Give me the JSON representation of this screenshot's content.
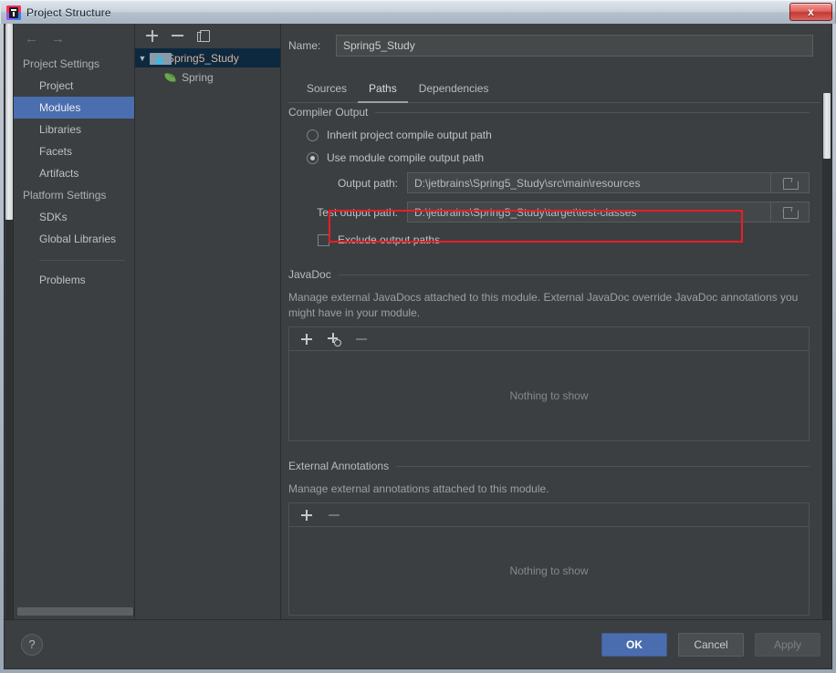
{
  "window": {
    "title": "Project Structure",
    "app_icon": "jetbrains-icon",
    "close_label": "x"
  },
  "sidebar": {
    "back_icon": "arrow-left-icon",
    "forward_icon": "arrow-right-icon",
    "groups": [
      {
        "label": "Project Settings",
        "items": [
          {
            "label": "Project",
            "selected": false
          },
          {
            "label": "Modules",
            "selected": true
          },
          {
            "label": "Libraries",
            "selected": false
          },
          {
            "label": "Facets",
            "selected": false
          },
          {
            "label": "Artifacts",
            "selected": false
          }
        ]
      },
      {
        "label": "Platform Settings",
        "items": [
          {
            "label": "SDKs",
            "selected": false
          },
          {
            "label": "Global Libraries",
            "selected": false
          }
        ]
      }
    ],
    "problems": {
      "label": "Problems"
    }
  },
  "tree": {
    "toolbar": [
      {
        "icon": "plus-icon",
        "label": "Add"
      },
      {
        "icon": "minus-icon",
        "label": "Remove"
      },
      {
        "icon": "copy-icon",
        "label": "Copy"
      }
    ],
    "root": {
      "label": "Spring5_Study",
      "icon": "module-folder-icon",
      "expanded": true,
      "selected": true
    },
    "children": [
      {
        "label": "Spring",
        "icon": "spring-leaf-icon"
      }
    ]
  },
  "main": {
    "name": {
      "label": "Name:",
      "value": "Spring5_Study",
      "placeholder": ""
    },
    "tabs": [
      {
        "label": "Sources",
        "active": false
      },
      {
        "label": "Paths",
        "active": true
      },
      {
        "label": "Dependencies",
        "active": false
      }
    ],
    "compiler_output": {
      "title": "Compiler Output",
      "radio_inherit": {
        "label": "Inherit project compile output path",
        "checked": false
      },
      "radio_module": {
        "label": "Use module compile output path",
        "checked": true
      },
      "output_path": {
        "label": "Output path:",
        "value": "D:\\jetbrains\\Spring5_Study\\src\\main\\resources",
        "browse_icon": "folder-icon",
        "highlighted": true
      },
      "test_output_path": {
        "label": "Test output path:",
        "value": "D:\\jetbrains\\Spring5_Study\\target\\test-classes",
        "browse_icon": "folder-icon"
      },
      "exclude_checkbox": {
        "label": "Exclude output paths",
        "checked": false
      }
    },
    "javadoc": {
      "title": "JavaDoc",
      "description": "Manage external JavaDocs attached to this module. External JavaDoc override JavaDoc annotations you might have in your module.",
      "toolbar": [
        {
          "icon": "plus-icon",
          "enabled": true
        },
        {
          "icon": "plus-web-icon",
          "enabled": true
        },
        {
          "icon": "minus-icon",
          "enabled": false
        }
      ],
      "empty_text": "Nothing to show"
    },
    "external_annotations": {
      "title": "External Annotations",
      "description": "Manage external annotations attached to this module.",
      "toolbar": [
        {
          "icon": "plus-icon",
          "enabled": true
        },
        {
          "icon": "minus-icon",
          "enabled": false
        }
      ],
      "empty_text": "Nothing to show"
    }
  },
  "footer": {
    "help_label": "?",
    "ok_label": "OK",
    "cancel_label": "Cancel",
    "apply_label": "Apply"
  },
  "colors": {
    "accent_selection": "#4b6eaf",
    "tree_selection": "#0d293f",
    "annotation_red": "#ec1c24",
    "primary_button": "#4a6daf",
    "background": "#3c3f41"
  }
}
